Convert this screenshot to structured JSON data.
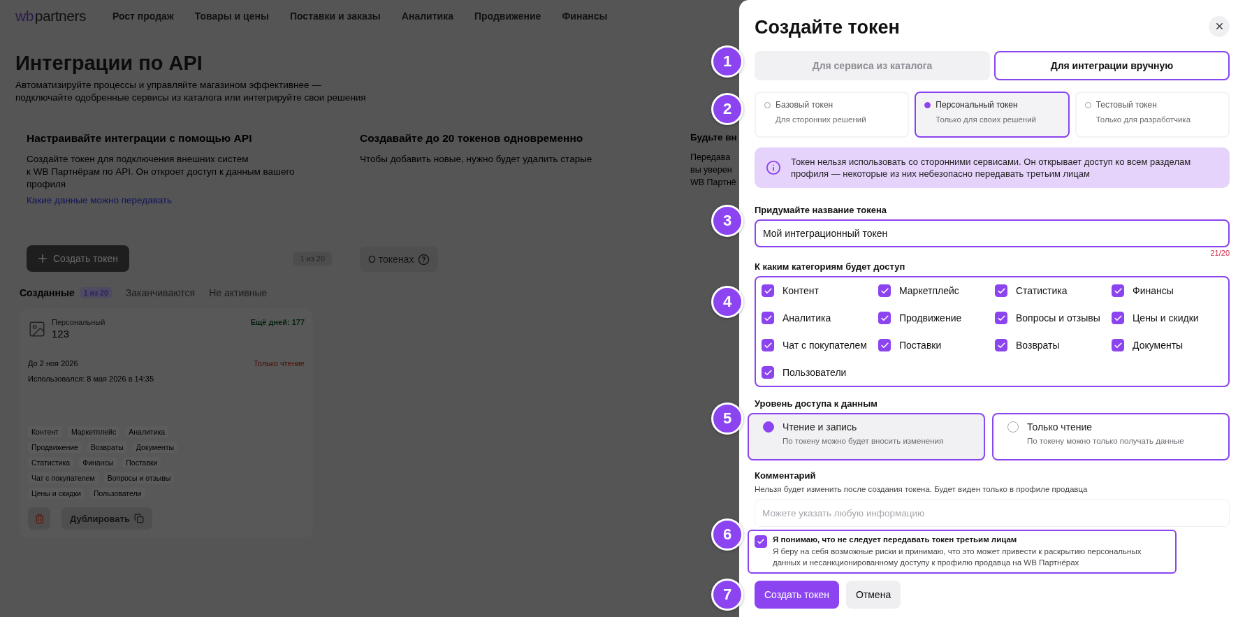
{
  "nav": {
    "logo_mark": "wb",
    "logo_text": "partners",
    "items": [
      "Рост продаж",
      "Товары и цены",
      "Поставки и заказы",
      "Аналитика",
      "Продвижение",
      "Финансы"
    ]
  },
  "page": {
    "title": "Интеграции по API",
    "subtitle": "Автоматизируйте процессы и управляйте магазином эффективнее —\nподключайте одобренные сервисы из каталога или интегрируйте свои решения"
  },
  "api_card": {
    "title": "Настраивайте интеграции с помощью API",
    "description": "Создайте токен для подключения внешних систем\nк WB Партнёрам по API. Он откроет доступ к данным вашего\nпрофиля",
    "link": "Какие данные можно передавать",
    "button": "Создать токен",
    "counter": "1 из 20"
  },
  "limit_card": {
    "title": "Создавайте до 20 токенов одновременно",
    "description": "Чтобы добавить новые, нужно будет удалить старые",
    "button": "О токенах"
  },
  "trust_card": {
    "title": "Будьте вн",
    "description": "Передава\nвы уверен\nWB Партнё"
  },
  "token_tabs": [
    {
      "label": "Созданные",
      "badge": "1 из 20",
      "selected": true
    },
    {
      "label": "Заканчиваются",
      "selected": false
    },
    {
      "label": "Не активные",
      "selected": false
    }
  ],
  "token_card": {
    "type": "Персональный",
    "name": "123",
    "days_left": "Ещё дней: 177",
    "expires": "До 2 ноя 2026",
    "access": "Только чтение",
    "last_used": "Использовался: 8 мая 2026 в 14:35",
    "tags": [
      [
        "Контент",
        "Маркетплейс",
        "Аналитика"
      ],
      [
        "Продвижение",
        "Возвраты",
        "Документы"
      ],
      [
        "Статистика",
        "Финансы",
        "Поставки"
      ],
      [
        "Чат с покупателем",
        "Вопросы и отзывы"
      ],
      [
        "Цены и скидки",
        "Пользователи"
      ]
    ],
    "duplicate_button": "Дублировать"
  },
  "panel": {
    "title": "Создайте токен",
    "mode_tabs": [
      {
        "label": "Для сервиса из каталога",
        "selected": false
      },
      {
        "label": "Для интеграции вручную",
        "selected": true
      }
    ],
    "token_types": [
      {
        "title": "Базовый токен",
        "subtitle": "Для сторонних решений",
        "selected": false
      },
      {
        "title": "Персональный токен",
        "subtitle": "Только для своих решений",
        "selected": true
      },
      {
        "title": "Тестовый токен",
        "subtitle": "Только для разработчика",
        "selected": false
      }
    ],
    "notice": "Токен нельзя использовать со сторонними сервисами. Он открывает доступ ко всем разделам профиля — некоторые из них небезопасно передавать третьим лицам",
    "name_field": {
      "label": "Придумайте название токена",
      "value": "Мой интеграционный токен",
      "counter": "21/20"
    },
    "categories": {
      "label": "К каким категориям будет доступ",
      "items": [
        {
          "label": "Контент",
          "checked": true
        },
        {
          "label": "Маркетплейс",
          "checked": true
        },
        {
          "label": "Статистика",
          "checked": true
        },
        {
          "label": "Финансы",
          "checked": true
        },
        {
          "label": "Аналитика",
          "checked": true
        },
        {
          "label": "Продвижение",
          "checked": true
        },
        {
          "label": "Вопросы и отзывы",
          "checked": true
        },
        {
          "label": "Цены и скидки",
          "checked": true
        },
        {
          "label": "Чат с покупателем",
          "checked": true
        },
        {
          "label": "Поставки",
          "checked": true
        },
        {
          "label": "Возвраты",
          "checked": true
        },
        {
          "label": "Документы",
          "checked": true
        },
        {
          "label": "Пользователи",
          "checked": true
        }
      ]
    },
    "access_level": {
      "label": "Уровень доступа к данным",
      "options": [
        {
          "title": "Чтение и запись",
          "subtitle": "По токену можно будет вносить изменения",
          "selected": true
        },
        {
          "title": "Только чтение",
          "subtitle": "По токену можно только получать данные",
          "selected": false
        }
      ]
    },
    "comment": {
      "label": "Комментарий",
      "hint": "Нельзя будет изменить после создания токена. Будет виден только в профиле продавца",
      "placeholder": "Можете указать любую информацию"
    },
    "consent": {
      "title": "Я понимаю, что не следует передавать токен третьим лицам",
      "text": "Я беру на себя возможные риски и принимаю, что это может привести к раскрытию персональных данных и несанкционированному доступу к профилю продавца на WB Партнёрах",
      "checked": true
    },
    "buttons": {
      "primary": "Создать токен",
      "secondary": "Отмена"
    }
  },
  "callouts": [
    "1",
    "2",
    "3",
    "4",
    "5",
    "6",
    "7"
  ]
}
